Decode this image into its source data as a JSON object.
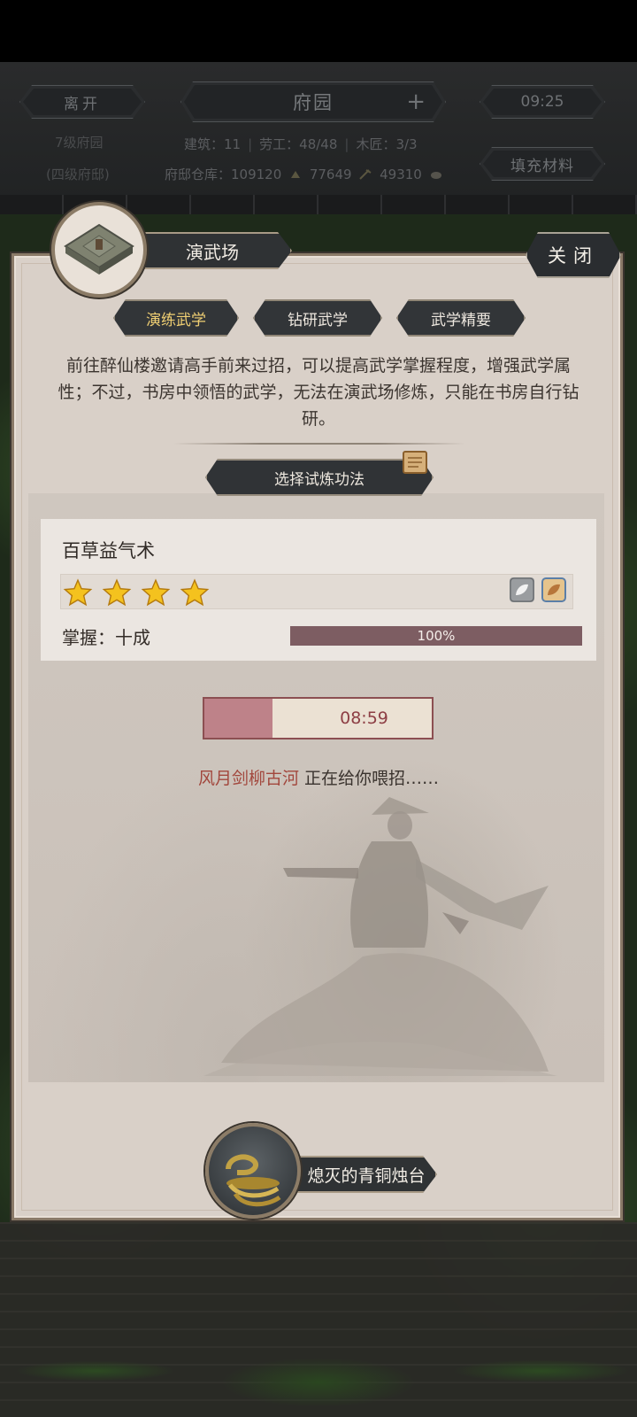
{
  "top": {
    "leave_label": "离开",
    "location_title": "府园",
    "add_symbol": "+",
    "clock": "09:25",
    "residence_level": "7级府园",
    "residence_sub": "(四级府邸)",
    "building_count": "建筑：11",
    "labor": "劳工：48/48",
    "carpenter": "木匠：3/3",
    "storage_label": "府邸仓库：109120",
    "stock_b": "77649",
    "stock_c": "49310",
    "fill_materials_label": "填充材料"
  },
  "panel": {
    "title": "演武场",
    "close_label": "关闭",
    "tabs": [
      {
        "label": "演练武学",
        "active": true
      },
      {
        "label": "钻研武学",
        "active": false
      },
      {
        "label": "武学精要",
        "active": false
      }
    ],
    "intro_text": "前往醉仙楼邀请高手前来过招，可以提高武学掌握程度，增强武学属性；不过，书房中领悟的武学，无法在演武场修炼，只能在书房自行钻研。",
    "select_method_label": "选择试炼功法"
  },
  "skill": {
    "name": "百草益气术",
    "stars": 4,
    "mastery_label": "掌握：十成",
    "mastery_percent_text": "100%",
    "mastery_fraction": 1.0
  },
  "training": {
    "timer_text": "08:59",
    "timer_fraction": 0.3,
    "partner_name": "风月剑柳古河",
    "status_text": " 正在给你喂招……"
  },
  "item": {
    "name": "熄灭的青铜烛台"
  },
  "colors": {
    "accent_gold": "#f0cf73",
    "mastery_bar": "#7d5d62",
    "timer_fill": "#be8289",
    "partner_name": "#a2473d"
  }
}
